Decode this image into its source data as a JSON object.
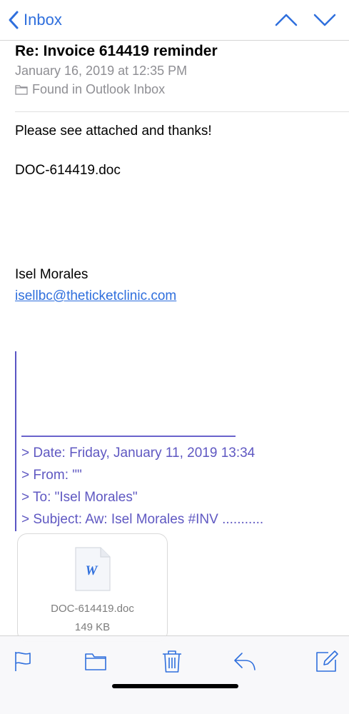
{
  "nav": {
    "back_label": "Inbox"
  },
  "header": {
    "subject": "Re: Invoice 614419 reminder",
    "date": "January 16, 2019 at 12:35 PM",
    "mailbox": "Found in Outlook Inbox"
  },
  "body": {
    "line1": "Please see attached and thanks!",
    "line2": "DOC-614419.doc",
    "signature_name": "Isel Morales",
    "signature_email": "isellbc@theticketclinic.com"
  },
  "quote": {
    "date": "> Date: Friday, January 11, 2019 13:34",
    "from": "> From: \"\"",
    "to": "> To: \"Isel Morales\"",
    "subject": "> Subject: Aw: Isel Morales #INV ..........."
  },
  "attachment": {
    "icon_letter": "W",
    "name": "DOC-614419.doc",
    "size": "149 KB"
  },
  "toolbar": {
    "icons": [
      "flag-icon",
      "folder-icon",
      "trash-icon",
      "reply-icon",
      "compose-icon"
    ]
  },
  "colors": {
    "accent": "#2f6fdd",
    "quote": "#5f58c2",
    "secondary_text": "#8e8e93"
  }
}
